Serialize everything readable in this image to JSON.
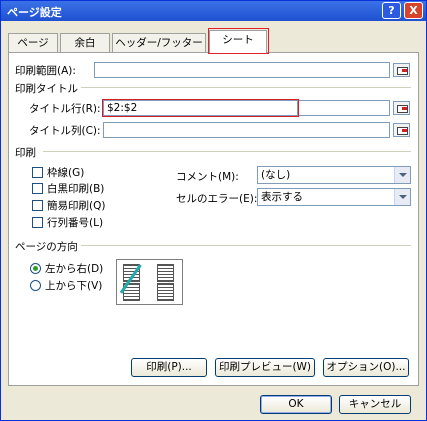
{
  "window": {
    "title": "ページ設定",
    "help_label": "?",
    "close_label": "X"
  },
  "tabs": [
    {
      "label": "ページ"
    },
    {
      "label": "余白"
    },
    {
      "label": "ヘッダー/フッター"
    },
    {
      "label": "シート"
    }
  ],
  "print_area": {
    "label": "印刷範囲(A):",
    "value": ""
  },
  "print_titles": {
    "heading": "印刷タイトル",
    "rows_label": "タイトル行(R):",
    "rows_value": "$2:$2",
    "cols_label": "タイトル列(C):",
    "cols_value": ""
  },
  "print": {
    "heading": "印刷",
    "checkboxes": [
      {
        "label": "枠線(G)",
        "checked": false
      },
      {
        "label": "白黒印刷(B)",
        "checked": false
      },
      {
        "label": "簡易印刷(Q)",
        "checked": false
      },
      {
        "label": "行列番号(L)",
        "checked": false
      }
    ],
    "comments_label": "コメント(M):",
    "comments_value": "(なし)",
    "errors_label": "セルのエラー(E):",
    "errors_value": "表示する"
  },
  "page_order": {
    "heading": "ページの方向",
    "options": [
      {
        "label": "左から右(D)",
        "selected": true
      },
      {
        "label": "上から下(V)",
        "selected": false
      }
    ]
  },
  "buttons": {
    "print": "印刷(P)...",
    "preview": "印刷プレビュー(W)",
    "options": "オプション(O)...",
    "ok": "OK",
    "cancel": "キャンセル"
  }
}
